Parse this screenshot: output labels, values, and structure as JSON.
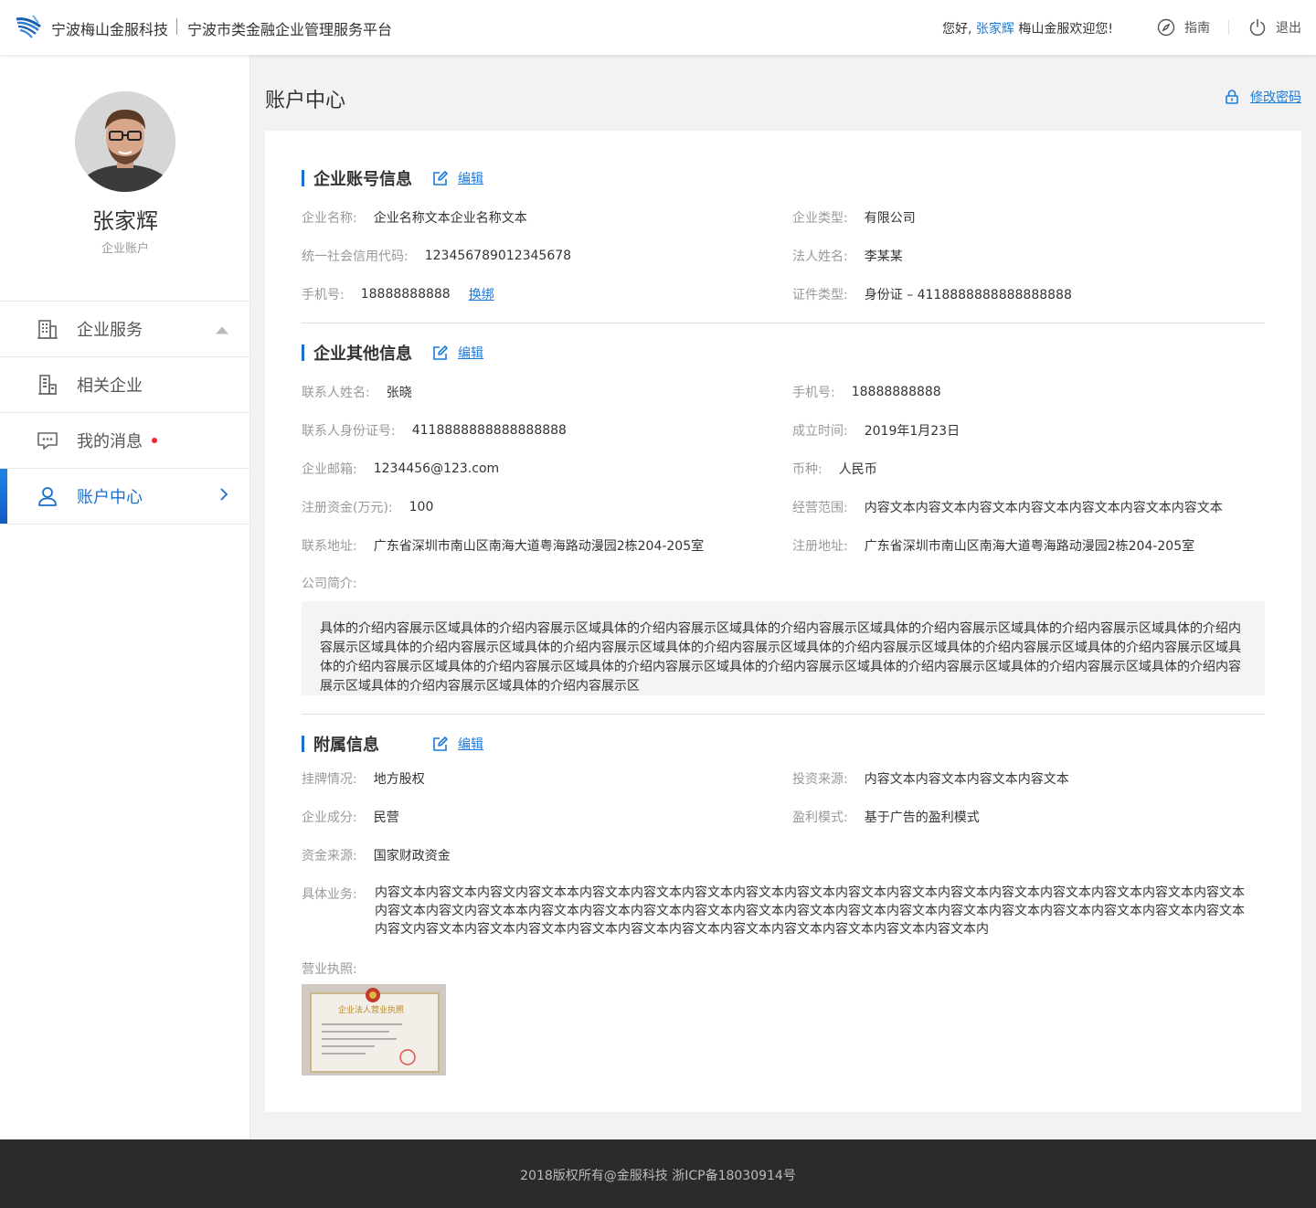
{
  "header": {
    "brand": "宁波梅山金服科技",
    "platform": "宁波市类金融企业管理服务平台",
    "greeting_prefix": "您好,",
    "user_name": "张家辉",
    "greeting_suffix": "梅山金服欢迎您!",
    "guide_label": "指南",
    "logout_label": "退出"
  },
  "sidebar": {
    "user_name": "张家辉",
    "user_type": "企业账户",
    "items": [
      {
        "label": "企业服务",
        "icon": "building-icon",
        "tail": "caret-up-icon"
      },
      {
        "label": "相关企业",
        "icon": "office-building-icon"
      },
      {
        "label": "我的消息",
        "icon": "message-icon",
        "badge": "red-dot"
      },
      {
        "label": "账户中心",
        "icon": "user-icon",
        "tail": "chevron-right-icon",
        "active": true
      }
    ]
  },
  "main": {
    "title": "账户中心",
    "change_password": "修改密码",
    "edit_label": "编辑",
    "account_section": {
      "title": "企业账号信息",
      "fields": {
        "company_name": {
          "label": "企业名称:",
          "value": "企业名称文本企业名称文本"
        },
        "company_type": {
          "label": "企业类型:",
          "value": "有限公司"
        },
        "credit_code": {
          "label": "统一社会信用代码:",
          "value": "123456789012345678"
        },
        "legal_person": {
          "label": "法人姓名:",
          "value": "李某某"
        },
        "phone": {
          "label": "手机号:",
          "value": "18888888888",
          "action": "换绑"
        },
        "id_type": {
          "label": "证件类型:",
          "value": "身份证 – 4118888888888888888"
        }
      }
    },
    "other_section": {
      "title": "企业其他信息",
      "fields": {
        "contact_name": {
          "label": "联系人姓名:",
          "value": "张晓"
        },
        "contact_phone": {
          "label": "手机号:",
          "value": "18888888888"
        },
        "contact_id": {
          "label": "联系人身份证号:",
          "value": "4118888888888888888"
        },
        "founded": {
          "label": "成立时间:",
          "value": "2019年1月23日"
        },
        "email": {
          "label": "企业邮箱:",
          "value": "1234456@123.com"
        },
        "currency": {
          "label": "币种:",
          "value": "人民币"
        },
        "capital": {
          "label": "注册资金(万元):",
          "value": "100"
        },
        "scope": {
          "label": "经营范围:",
          "value": "内容文本内容文本内容文本内容文本内容文本内容文本内容文本"
        },
        "contact_address": {
          "label": "联系地址:",
          "value": "广东省深圳市南山区南海大道粤海路动漫园2栋204-205室"
        },
        "reg_address": {
          "label": "注册地址:",
          "value": "广东省深圳市南山区南海大道粤海路动漫园2栋204-205室"
        }
      },
      "intro_label": "公司简介:",
      "intro_text": "具体的介绍内容展示区域具体的介绍内容展示区域具体的介绍内容展示区域具体的介绍内容展示区域具体的介绍内容展示区域具体的介绍内容展示区域具体的介绍内容展示区域具体的介绍内容展示区域具体的介绍内容展示区域具体的介绍内容展示区域具体的介绍内容展示区域具体的介绍内容展示区域具体的介绍内容展示区域具体的介绍内容展示区域具体的介绍内容展示区域具体的介绍内容展示区域具体的介绍内容展示区域具体的介绍内容展示区域具体的介绍内容展示区域具体的介绍内容展示区域具体的介绍内容展示区域具体的介绍内容展示区"
    },
    "attach_section": {
      "title": "附属信息",
      "fields": {
        "listing": {
          "label": "挂牌情况:",
          "value": "地方股权"
        },
        "investment": {
          "label": "投资来源:",
          "value": "内容文本内容文本内容文本内容文本"
        },
        "ownership": {
          "label": "企业成分:",
          "value": "民营"
        },
        "profit_model": {
          "label": "盈利模式:",
          "value": "基于广告的盈利模式"
        },
        "fund_source": {
          "label": "资金来源:",
          "value": "国家财政资金"
        }
      },
      "business_label": "具体业务:",
      "business_text": "内容文本内容文本内容文内容文本本内容文本内容文本内容文本内容文本内容文本内容文本内容文本内容文本内容文本内容文本内容文本内容文本内容文本内容文本内容文内容文本本内容文本内容文本内容文本内容文本内容文本内容文本内容文本内容文本内容文本内容文本内容文本内容文本内容文本内容文本内容文内容文本内容文本内容文本内容文本内容文本内容文本内容文本内容文本内容文本内容文本内容文本内",
      "license_label": "营业执照:",
      "license_caption": "企业法人营业执照"
    }
  },
  "footer": {
    "text": "2018版权所有@金服科技   浙ICP备18030914号"
  },
  "colors": {
    "accent": "#1a7ad9",
    "active_bar": "#1a6fd1",
    "footer_bg": "#2b2b2b",
    "badge": "#f5222d"
  }
}
